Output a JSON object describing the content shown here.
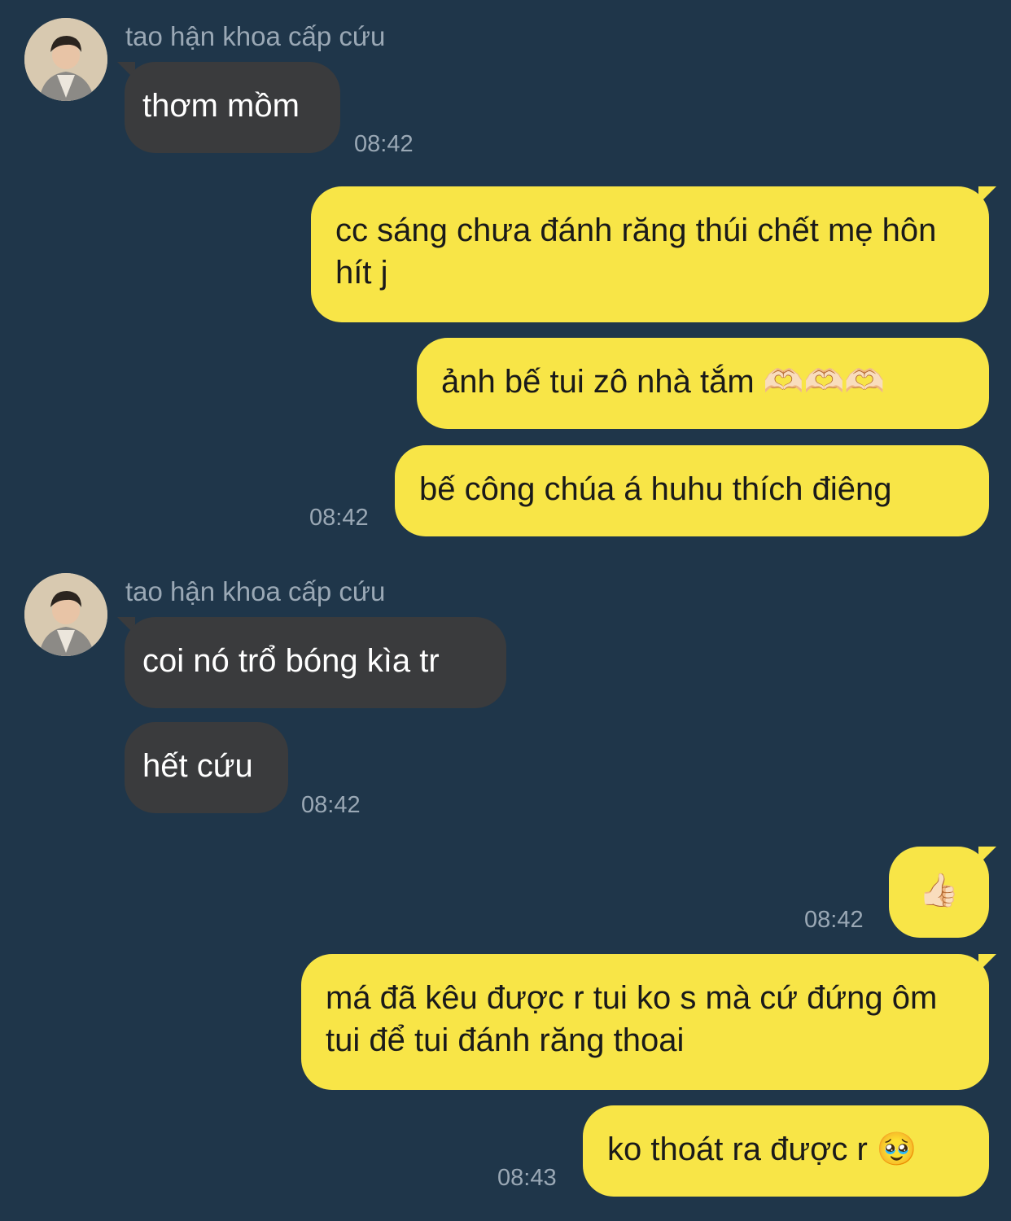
{
  "contact": {
    "name": "tao hận khoa cấp cứu"
  },
  "messages": [
    {
      "direction": "in",
      "text": "thơm mồm",
      "time": "08:42"
    },
    {
      "direction": "out",
      "text": "cc sáng chưa đánh răng thúi chết mẹ hôn hít j"
    },
    {
      "direction": "out",
      "text": "ảnh bế tui zô nhà tắm 🫶🏻🫶🏻🫶🏻"
    },
    {
      "direction": "out",
      "text": "bế công chúa á huhu thích điêng",
      "time": "08:42"
    },
    {
      "direction": "in",
      "text": "coi nó trổ bóng kìa tr"
    },
    {
      "direction": "in",
      "text": "hết cứu",
      "time": "08:42"
    },
    {
      "direction": "out",
      "text": "👍🏻",
      "time": "08:42"
    },
    {
      "direction": "out",
      "text": "má đã kêu được r tui ko s mà cứ đứng ôm tui để tui đánh răng thoai"
    },
    {
      "direction": "out",
      "text": "ko thoát ra được r 🥹",
      "time": "08:43"
    }
  ],
  "colors": {
    "background": "#1f364a",
    "incoming_bubble": "#3a3b3d",
    "outgoing_bubble": "#f8e547",
    "meta_text": "#9aa8b5"
  }
}
